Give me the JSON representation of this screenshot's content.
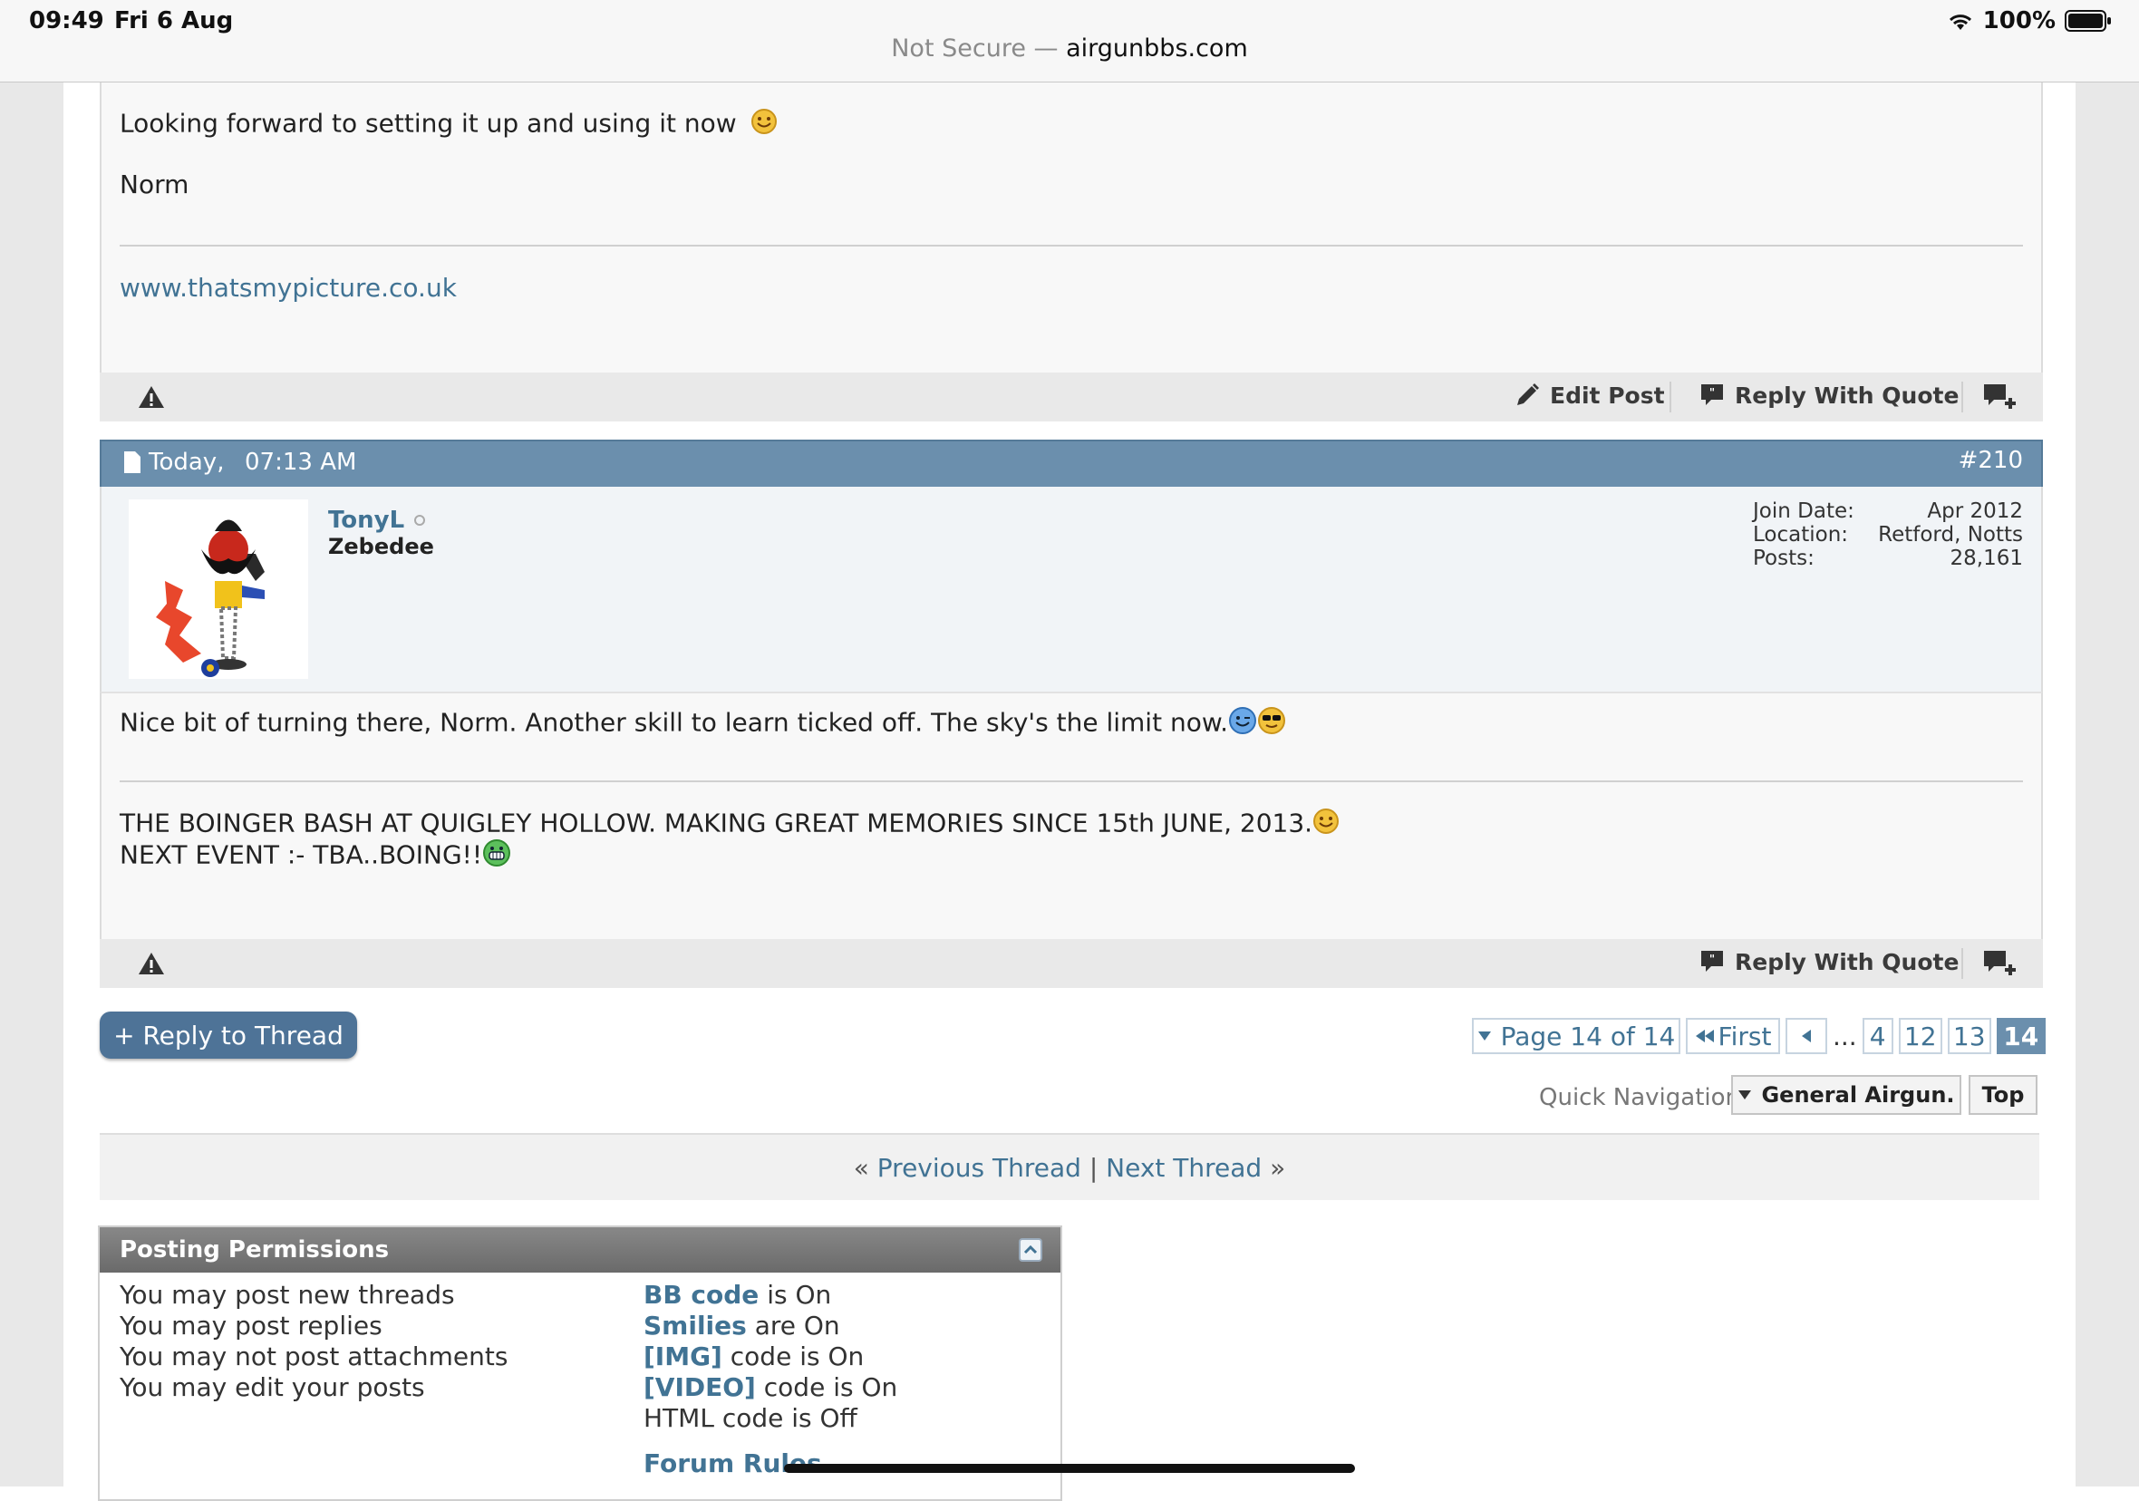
{
  "status_bar": {
    "time": "09:49",
    "date": "Fri 6 Aug",
    "battery": "100%",
    "url_prefix": "Not Secure —",
    "url_domain": "airgunbbs.com"
  },
  "post1": {
    "line1": "Looking forward to setting it up and using it now",
    "signoff": "Norm",
    "sig_link": "www.thatsmypicture.co.uk",
    "edit_label": "Edit Post",
    "reply_quote_label": "Reply With Quote"
  },
  "post2": {
    "date": "Today,",
    "time": "07:13 AM",
    "number": "#210",
    "username": "TonyL",
    "user_title": "Zebedee",
    "join_label": "Join Date:",
    "join_value": "Apr 2012",
    "location_label": "Location:",
    "location_value": "Retford, Notts",
    "posts_label": "Posts:",
    "posts_value": "28,161",
    "body": "Nice bit of turning there, Norm. Another skill to learn ticked off. The sky's the limit now.",
    "sig_line1": "THE BOINGER BASH AT QUIGLEY HOLLOW. MAKING GREAT MEMORIES SINCE 15th JUNE, 2013.",
    "sig_line2": "NEXT EVENT :- TBA..BOING!!",
    "reply_quote_label": "Reply With Quote"
  },
  "actions": {
    "reply_thread": "+ Reply to Thread"
  },
  "pagination": {
    "page_label": "Page 14 of 14",
    "first_label": "First",
    "ellipsis": "...",
    "pages": [
      "4",
      "12",
      "13",
      "14"
    ],
    "current": "14"
  },
  "quick_nav": {
    "label": "Quick Navigation",
    "forum_select": "General Airgun.",
    "top": "Top"
  },
  "thread_nav": {
    "prev": "Previous Thread",
    "next": "Next Thread",
    "prev_mark": "«",
    "sep": "|",
    "next_mark": "»"
  },
  "permissions": {
    "title": "Posting Permissions",
    "left": [
      "You may post new threads",
      "You may post replies",
      "You may not post attachments",
      "You may edit your posts"
    ],
    "right": [
      {
        "term": "BB code",
        "rest": "is On"
      },
      {
        "term": "Smilies",
        "rest": "are On"
      },
      {
        "term": "[IMG]",
        "rest": "code is On"
      },
      {
        "term": "[VIDEO]",
        "rest": "code is On"
      },
      {
        "term": "",
        "rest": "HTML code is Off"
      }
    ],
    "forum_rules": "Forum Rules"
  },
  "colors": {
    "accent": "#6b8fad",
    "link": "#417394",
    "reply_button": "#4e7397"
  }
}
